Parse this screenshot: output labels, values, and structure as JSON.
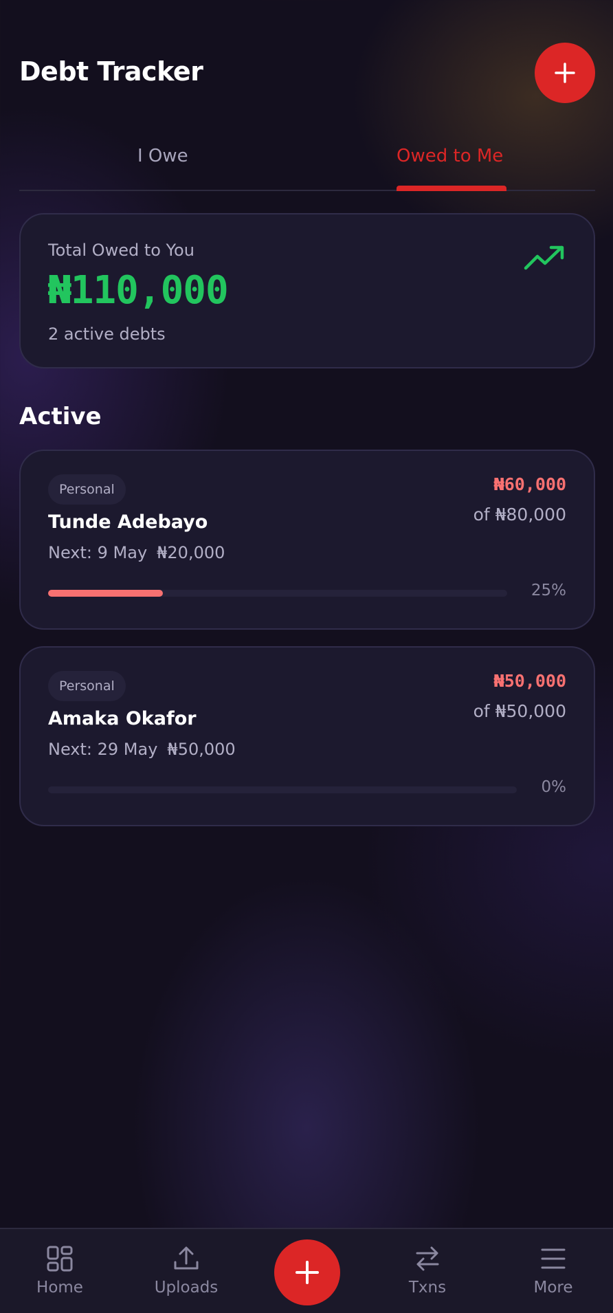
{
  "header": {
    "title": "Debt Tracker",
    "add_icon": "plus-icon"
  },
  "tabs": [
    {
      "label": "I Owe",
      "active": false
    },
    {
      "label": "Owed to Me",
      "active": true
    }
  ],
  "summary": {
    "label": "Total Owed to You",
    "amount": "₦110,000",
    "count": "2 active debts",
    "icon": "trending-up-icon"
  },
  "section": {
    "title": "Active"
  },
  "debts": [
    {
      "category": "Personal",
      "name": "Tunde Adebayo",
      "next_date": "Next: 9 May",
      "next_amount": "₦20,000",
      "remaining": "₦60,000",
      "total": "of ₦80,000",
      "progress": 0.25,
      "progress_label": "25%"
    },
    {
      "category": "Personal",
      "name": "Amaka Okafor",
      "next_date": "Next: 29 May",
      "next_amount": "₦50,000",
      "remaining": "₦50,000",
      "total": "of ₦50,000",
      "progress": 0,
      "progress_label": "0%"
    }
  ],
  "nav": {
    "items": [
      {
        "label": "Home",
        "icon": "grid-icon"
      },
      {
        "label": "Uploads",
        "icon": "upload-icon"
      },
      {
        "label": "Txns",
        "icon": "transfer-icon"
      },
      {
        "label": "More",
        "icon": "menu-icon"
      }
    ],
    "fab_icon": "plus-icon"
  },
  "colors": {
    "accent": "#dc2626",
    "positive": "#22c55e",
    "debt": "#f87171",
    "background": "#130f1e",
    "card": "#1c192e"
  }
}
